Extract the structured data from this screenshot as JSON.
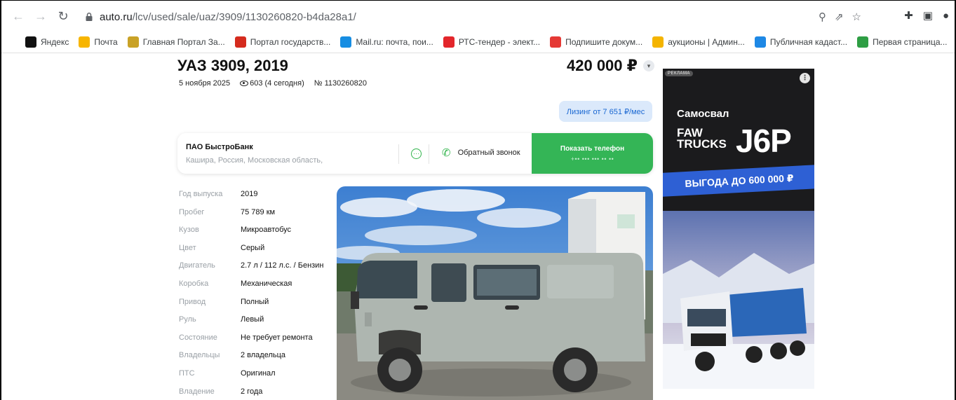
{
  "browser": {
    "url_domain": "auto.ru",
    "url_path": "/lcv/used/sale/uaz/3909/1130260820-b4da28a1/",
    "bookmarks": [
      {
        "label": "Яндекс",
        "color": "#111111",
        "icon": "yandex-icon"
      },
      {
        "label": "Почта",
        "color": "#f7b500",
        "icon": "mail-icon"
      },
      {
        "label": "Главная Портал За...",
        "color": "#c9a227",
        "icon": "emblem-icon"
      },
      {
        "label": "Портал государств...",
        "color": "#d52b1e",
        "icon": "flag-icon"
      },
      {
        "label": "Mail.ru: почта, пои...",
        "color": "#168de2",
        "icon": "at-icon"
      },
      {
        "label": "РТС-тендер - элект...",
        "color": "#e3262b",
        "icon": "rts-icon"
      },
      {
        "label": "Подпишите докум...",
        "color": "#e53935",
        "icon": "key-icon"
      },
      {
        "label": "аукционы | Админ...",
        "color": "#f4b400",
        "icon": "auction-icon"
      },
      {
        "label": "Публичная кадаст...",
        "color": "#1e88e5",
        "icon": "cadastre-icon"
      },
      {
        "label": "Первая страница...",
        "color": "#2e9e44",
        "icon": "arrow-icon"
      }
    ]
  },
  "listing": {
    "title": "УАЗ 3909, 2019",
    "date": "5 ноября 2025",
    "views": "603 (4 сегодня)",
    "number": "№ 1130260820",
    "price": "420 000 ₽",
    "leasing": "Лизинг от 7 651 ₽/мес"
  },
  "seller": {
    "name": "ПАО БыстроБанк",
    "location": "Кашира, Россия, Московская область,",
    "callback": "Обратный звонок",
    "show_phone": "Показать телефон",
    "phone_mask": "+•• ••• ••• •• ••"
  },
  "specs": [
    {
      "label": "Год выпуска",
      "value": "2019"
    },
    {
      "label": "Пробег",
      "value": "75 789 км"
    },
    {
      "label": "Кузов",
      "value": "Микроавтобус"
    },
    {
      "label": "Цвет",
      "value": "Серый"
    },
    {
      "label": "Двигатель",
      "value": "2.7 л / 112 л.с. / Бензин"
    },
    {
      "label": "Коробка",
      "value": "Механическая"
    },
    {
      "label": "Привод",
      "value": "Полный"
    },
    {
      "label": "Руль",
      "value": "Левый"
    },
    {
      "label": "Состояние",
      "value": "Не требует ремонта"
    },
    {
      "label": "Владельцы",
      "value": "2 владельца"
    },
    {
      "label": "ПТС",
      "value": "Оригинал"
    },
    {
      "label": "Владение",
      "value": "2 года"
    }
  ],
  "ad": {
    "badge": "РЕКЛАМА",
    "line1": "Самосвал",
    "line2": "FAW TRUCKS",
    "line3": "J6P",
    "banner": "ВЫГОДА ДО 600 000 ₽"
  }
}
